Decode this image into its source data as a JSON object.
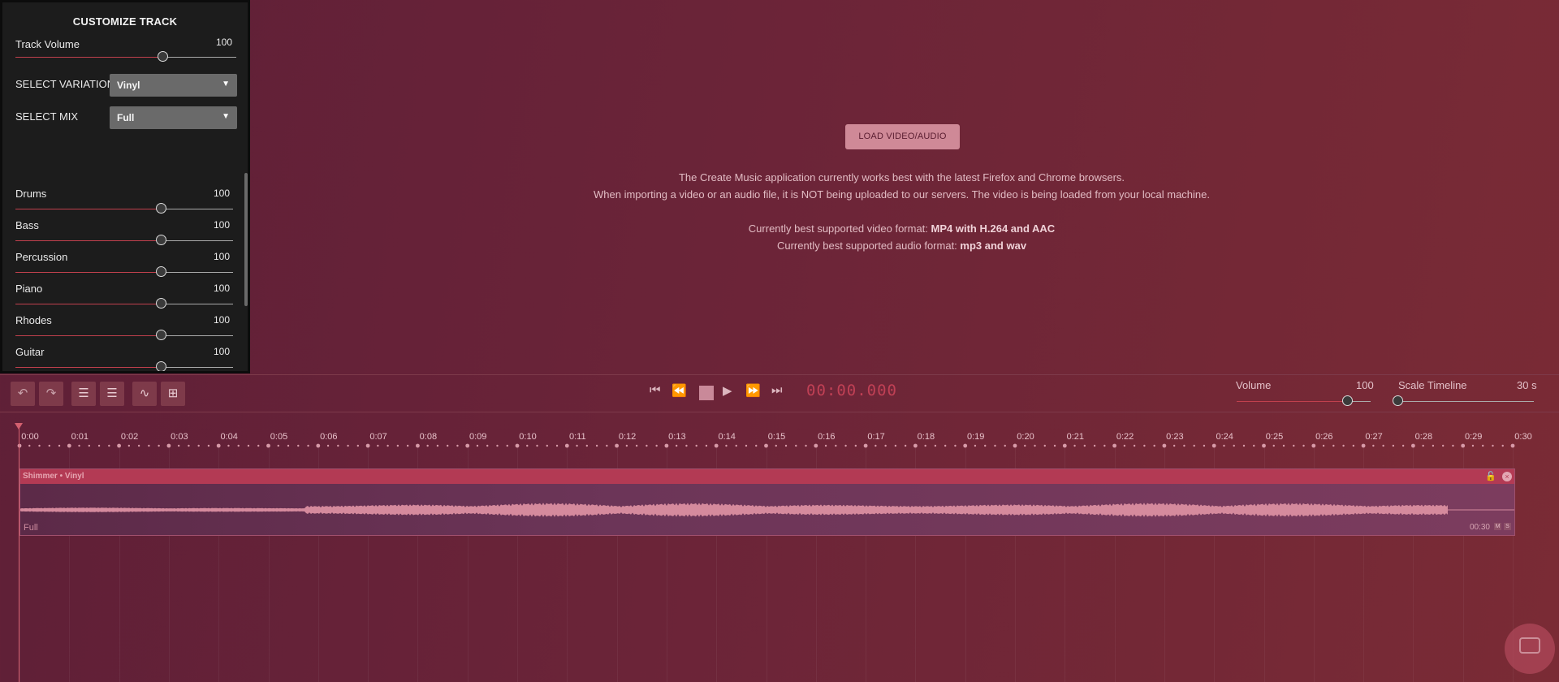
{
  "panel": {
    "title": "CUSTOMIZE TRACK",
    "track_volume_label": "Track Volume",
    "track_volume_value": "100",
    "track_volume_level": 0.67,
    "variation_label": "SELECT VARIATION",
    "variation_value": "Vinyl",
    "mix_label": "SELECT MIX",
    "mix_value": "Full",
    "stems": [
      {
        "label": "Drums",
        "value": "100",
        "level": 0.67
      },
      {
        "label": "Bass",
        "value": "100",
        "level": 0.67
      },
      {
        "label": "Percussion",
        "value": "100",
        "level": 0.67
      },
      {
        "label": "Piano",
        "value": "100",
        "level": 0.67
      },
      {
        "label": "Rhodes",
        "value": "100",
        "level": 0.67
      },
      {
        "label": "Guitar",
        "value": "100",
        "level": 0.67
      }
    ]
  },
  "video": {
    "load_button": "LOAD VIDEO/AUDIO",
    "info_line1": "The Create Music application currently works best with the latest Firefox and Chrome browsers.",
    "info_line2": "When importing a video or an audio file, it is NOT being uploaded to our servers. The video is being loaded from your local machine.",
    "video_format_prefix": "Currently best supported video format: ",
    "video_format": "MP4 with H.264 and AAC",
    "audio_format_prefix": "Currently best supported audio format: ",
    "audio_format": "mp3 and wav"
  },
  "transport": {
    "timecode": "00:00.000",
    "volume_label": "Volume",
    "volume_value": "100",
    "volume_level": 0.83,
    "scale_label": "Scale Timeline",
    "scale_value": "30 s",
    "scale_level": 0.0
  },
  "timeline": {
    "ticks": [
      "0:00",
      "0:01",
      "0:02",
      "0:03",
      "0:04",
      "0:05",
      "0:06",
      "0:07",
      "0:08",
      "0:09",
      "0:10",
      "0:11",
      "0:12",
      "0:13",
      "0:14",
      "0:15",
      "0:16",
      "0:17",
      "0:18",
      "0:19",
      "0:20",
      "0:21",
      "0:22",
      "0:23",
      "0:24",
      "0:25",
      "0:26",
      "0:27",
      "0:28",
      "0:29",
      "0:30"
    ]
  },
  "clip": {
    "title": "Shimmer • Vinyl",
    "mix": "Full",
    "duration": "00:30",
    "btn_m": "M",
    "btn_s": "S"
  },
  "colors": {
    "accent": "#c0404d",
    "clip_header": "#b33a54",
    "waveform": "#d58a9d"
  }
}
